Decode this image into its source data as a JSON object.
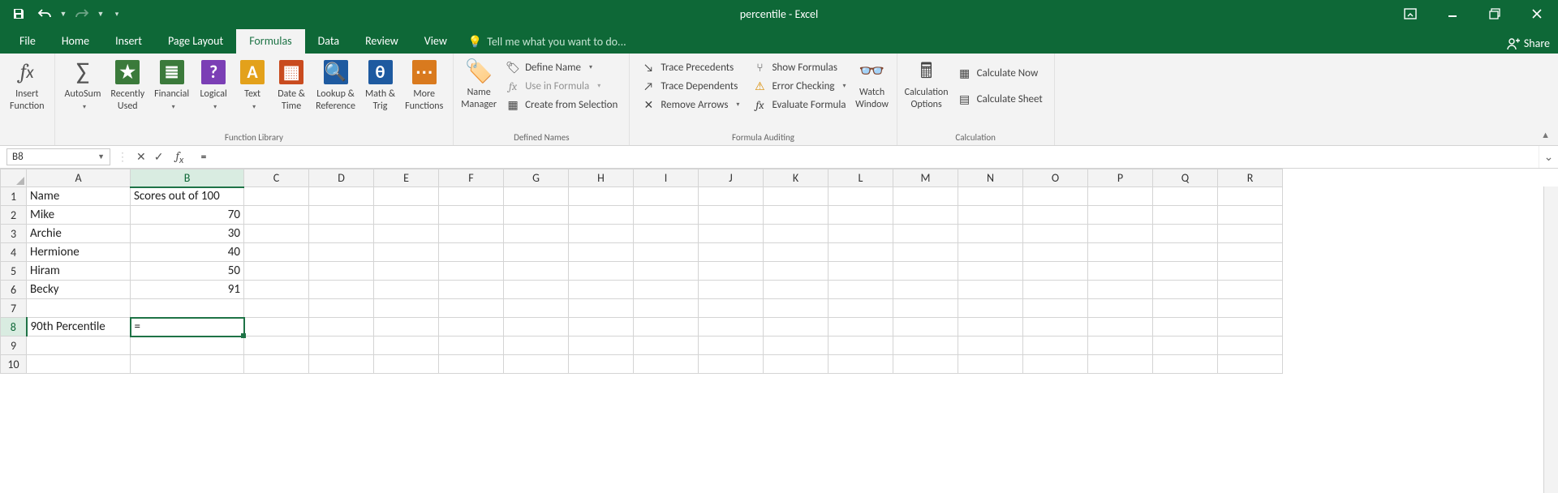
{
  "titlebar": {
    "title": "percentile - Excel"
  },
  "tabs": {
    "file": "File",
    "home": "Home",
    "insert": "Insert",
    "page_layout": "Page Layout",
    "formulas": "Formulas",
    "data": "Data",
    "review": "Review",
    "view": "View",
    "tellme": "Tell me what you want to do...",
    "share": "Share"
  },
  "ribbon": {
    "insert_function": "Insert\nFunction",
    "autosum": "AutoSum",
    "recently_used": "Recently\nUsed",
    "financial": "Financial",
    "logical": "Logical",
    "text": "Text",
    "date_time": "Date &\nTime",
    "lookup_ref": "Lookup &\nReference",
    "math_trig": "Math &\nTrig",
    "more_funcs": "More\nFunctions",
    "name_manager": "Name\nManager",
    "define_name": "Define Name",
    "use_in_formula": "Use in Formula",
    "create_from_sel": "Create from Selection",
    "trace_prec": "Trace Precedents",
    "trace_dep": "Trace Dependents",
    "remove_arrows": "Remove Arrows",
    "show_formulas": "Show Formulas",
    "error_checking": "Error Checking",
    "evaluate_formula": "Evaluate Formula",
    "watch_window": "Watch\nWindow",
    "calc_options": "Calculation\nOptions",
    "calc_now": "Calculate Now",
    "calc_sheet": "Calculate Sheet",
    "grp_funclib": "Function Library",
    "grp_defnames": "Defined Names",
    "grp_audit": "Formula Auditing",
    "grp_calc": "Calculation"
  },
  "fxbar": {
    "namebox": "B8",
    "formula": "="
  },
  "columns": [
    "A",
    "B",
    "C",
    "D",
    "E",
    "F",
    "G",
    "H",
    "I",
    "J",
    "K",
    "L",
    "M",
    "N",
    "O",
    "P",
    "Q",
    "R"
  ],
  "chart_data": {
    "type": "table",
    "headers": [
      "Name",
      "Scores out of 100"
    ],
    "rows": [
      {
        "name": "Mike",
        "score": 70
      },
      {
        "name": "Archie",
        "score": 30
      },
      {
        "name": "Hermione",
        "score": 40
      },
      {
        "name": "Hiram",
        "score": 50
      },
      {
        "name": "Becky",
        "score": 91
      }
    ],
    "label_row": {
      "label": "90th Percentile",
      "value": "="
    }
  }
}
